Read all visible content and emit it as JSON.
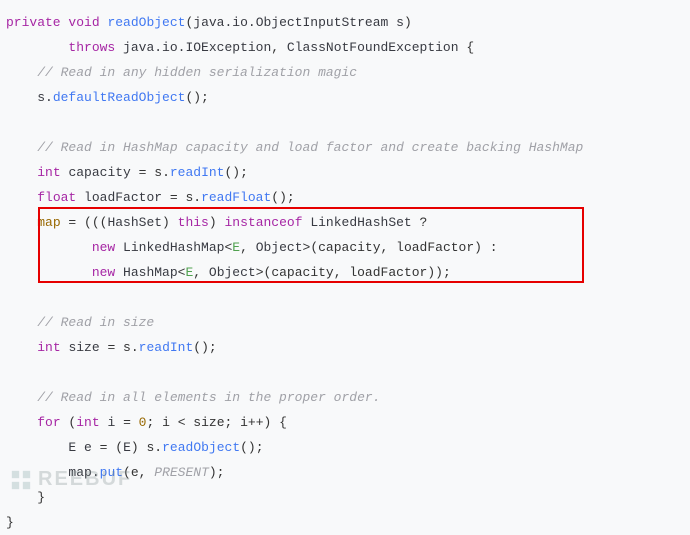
{
  "code": {
    "l1_private": "private",
    "l1_void": "void",
    "l1_method": "readObject",
    "l1_paramtype": "java.io.ObjectInputStream",
    "l1_param": "s",
    "l2_throws": "throws",
    "l2_e1": "java.io.IOException",
    "l2_e2": "ClassNotFoundException",
    "l3_comment": "// Read in any hidden serialization magic",
    "l4a": "s.",
    "l4m": "defaultReadObject",
    "l6_comment": "// Read in HashMap capacity and load factor and create backing HashMap",
    "l7_int": "int",
    "l7_var": "capacity",
    "l7_eq": " = s.",
    "l7_m": "readInt",
    "l8_float": "float",
    "l8_var": "loadFactor",
    "l8_eq": " = s.",
    "l8_m": "readFloat",
    "l9_map": "map",
    "l9_eq": " = (((",
    "l9_hs": "HashSet",
    "l9_this": "this",
    "l9_inst": "instanceof",
    "l9_lhs": "LinkedHashSet",
    "l10_new": "new",
    "l10_type": "LinkedHashMap",
    "l10_g1": "E",
    "l10_g2": "Object",
    "l10_args": "(capacity, loadFactor) :",
    "l11_new": "new",
    "l11_type": "HashMap",
    "l11_g1": "E",
    "l11_g2": "Object",
    "l11_args": "(capacity, loadFactor));",
    "l13_comment": "// Read in size",
    "l14_int": "int",
    "l14_var": "size",
    "l14_eq": " = s.",
    "l14_m": "readInt",
    "l16_comment": "// Read in all elements in the proper order.",
    "l17_for": "for",
    "l17_int": "int",
    "l17_var": "i",
    "l17_zero": "0",
    "l18_E": "E",
    "l18_e": "e",
    "l18_eq": " = (",
    "l18_E2": "E",
    "l18_rest": ") s.",
    "l18_m": "readObject",
    "l19_map": "map.",
    "l19_put": "put",
    "l19_args": "(e, ",
    "l19_present": "PRESENT"
  },
  "watermark": {
    "text": "REEBUF"
  }
}
